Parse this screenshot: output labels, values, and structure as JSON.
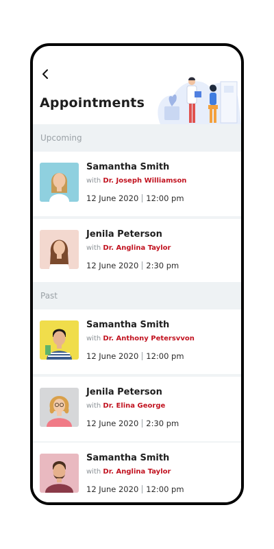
{
  "header": {
    "title": "Appointments"
  },
  "sections": {
    "upcoming": "Upcoming",
    "past": "Past"
  },
  "with_label": "with",
  "appointments": [
    {
      "name": "Samantha Smith",
      "doctor": "Dr. Joseph Williamson",
      "date": "12 June 2020",
      "time": "12:00 pm",
      "avatar_bg": "#8fd0df"
    },
    {
      "name": "Jenila Peterson",
      "doctor": "Dr. Anglina Taylor",
      "date": "12 June 2020",
      "time": "2:30 pm",
      "avatar_bg": "#f3d8cf"
    },
    {
      "name": "Samantha Smith",
      "doctor": "Dr. Anthony Petersvvon",
      "date": "12 June 2020",
      "time": "12:00 pm",
      "avatar_bg": "#f0dd4b"
    },
    {
      "name": "Jenila Peterson",
      "doctor": "Dr. Elina George",
      "date": "12 June 2020",
      "time": "2:30 pm",
      "avatar_bg": "#d6d7d9"
    },
    {
      "name": "Samantha Smith",
      "doctor": "Dr. Anglina Taylor",
      "date": "12 June 2020",
      "time": "12:00 pm",
      "avatar_bg": "#e9b9c0"
    }
  ],
  "colors": {
    "accent": "#c1121f",
    "section_bg": "#eef2f4"
  }
}
